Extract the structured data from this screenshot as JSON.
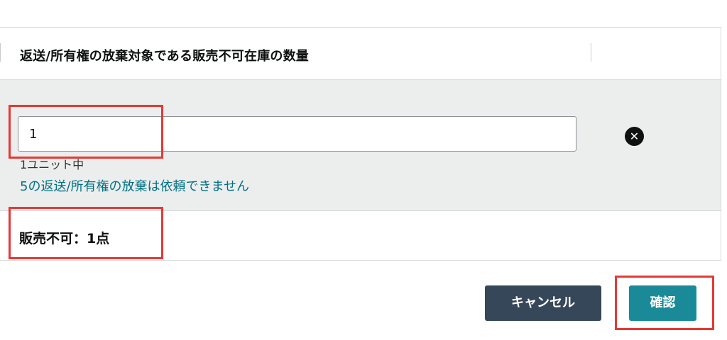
{
  "table": {
    "header_title": "返送/所有権の放棄対象である販売不可在庫の数量"
  },
  "item": {
    "quantity_value": "1",
    "units_text": "1ユニット中",
    "link_text": "5の返送/所有権の放棄は依頼できません",
    "remove_icon_glyph": "✕",
    "summary_text": "販売不可：1点"
  },
  "actions": {
    "cancel_label": "キャンセル",
    "confirm_label": "確認"
  },
  "colors": {
    "link": "#007185",
    "cancel_bg": "#37475a",
    "confirm_bg": "#1a8a99",
    "highlight": "#e53935"
  }
}
